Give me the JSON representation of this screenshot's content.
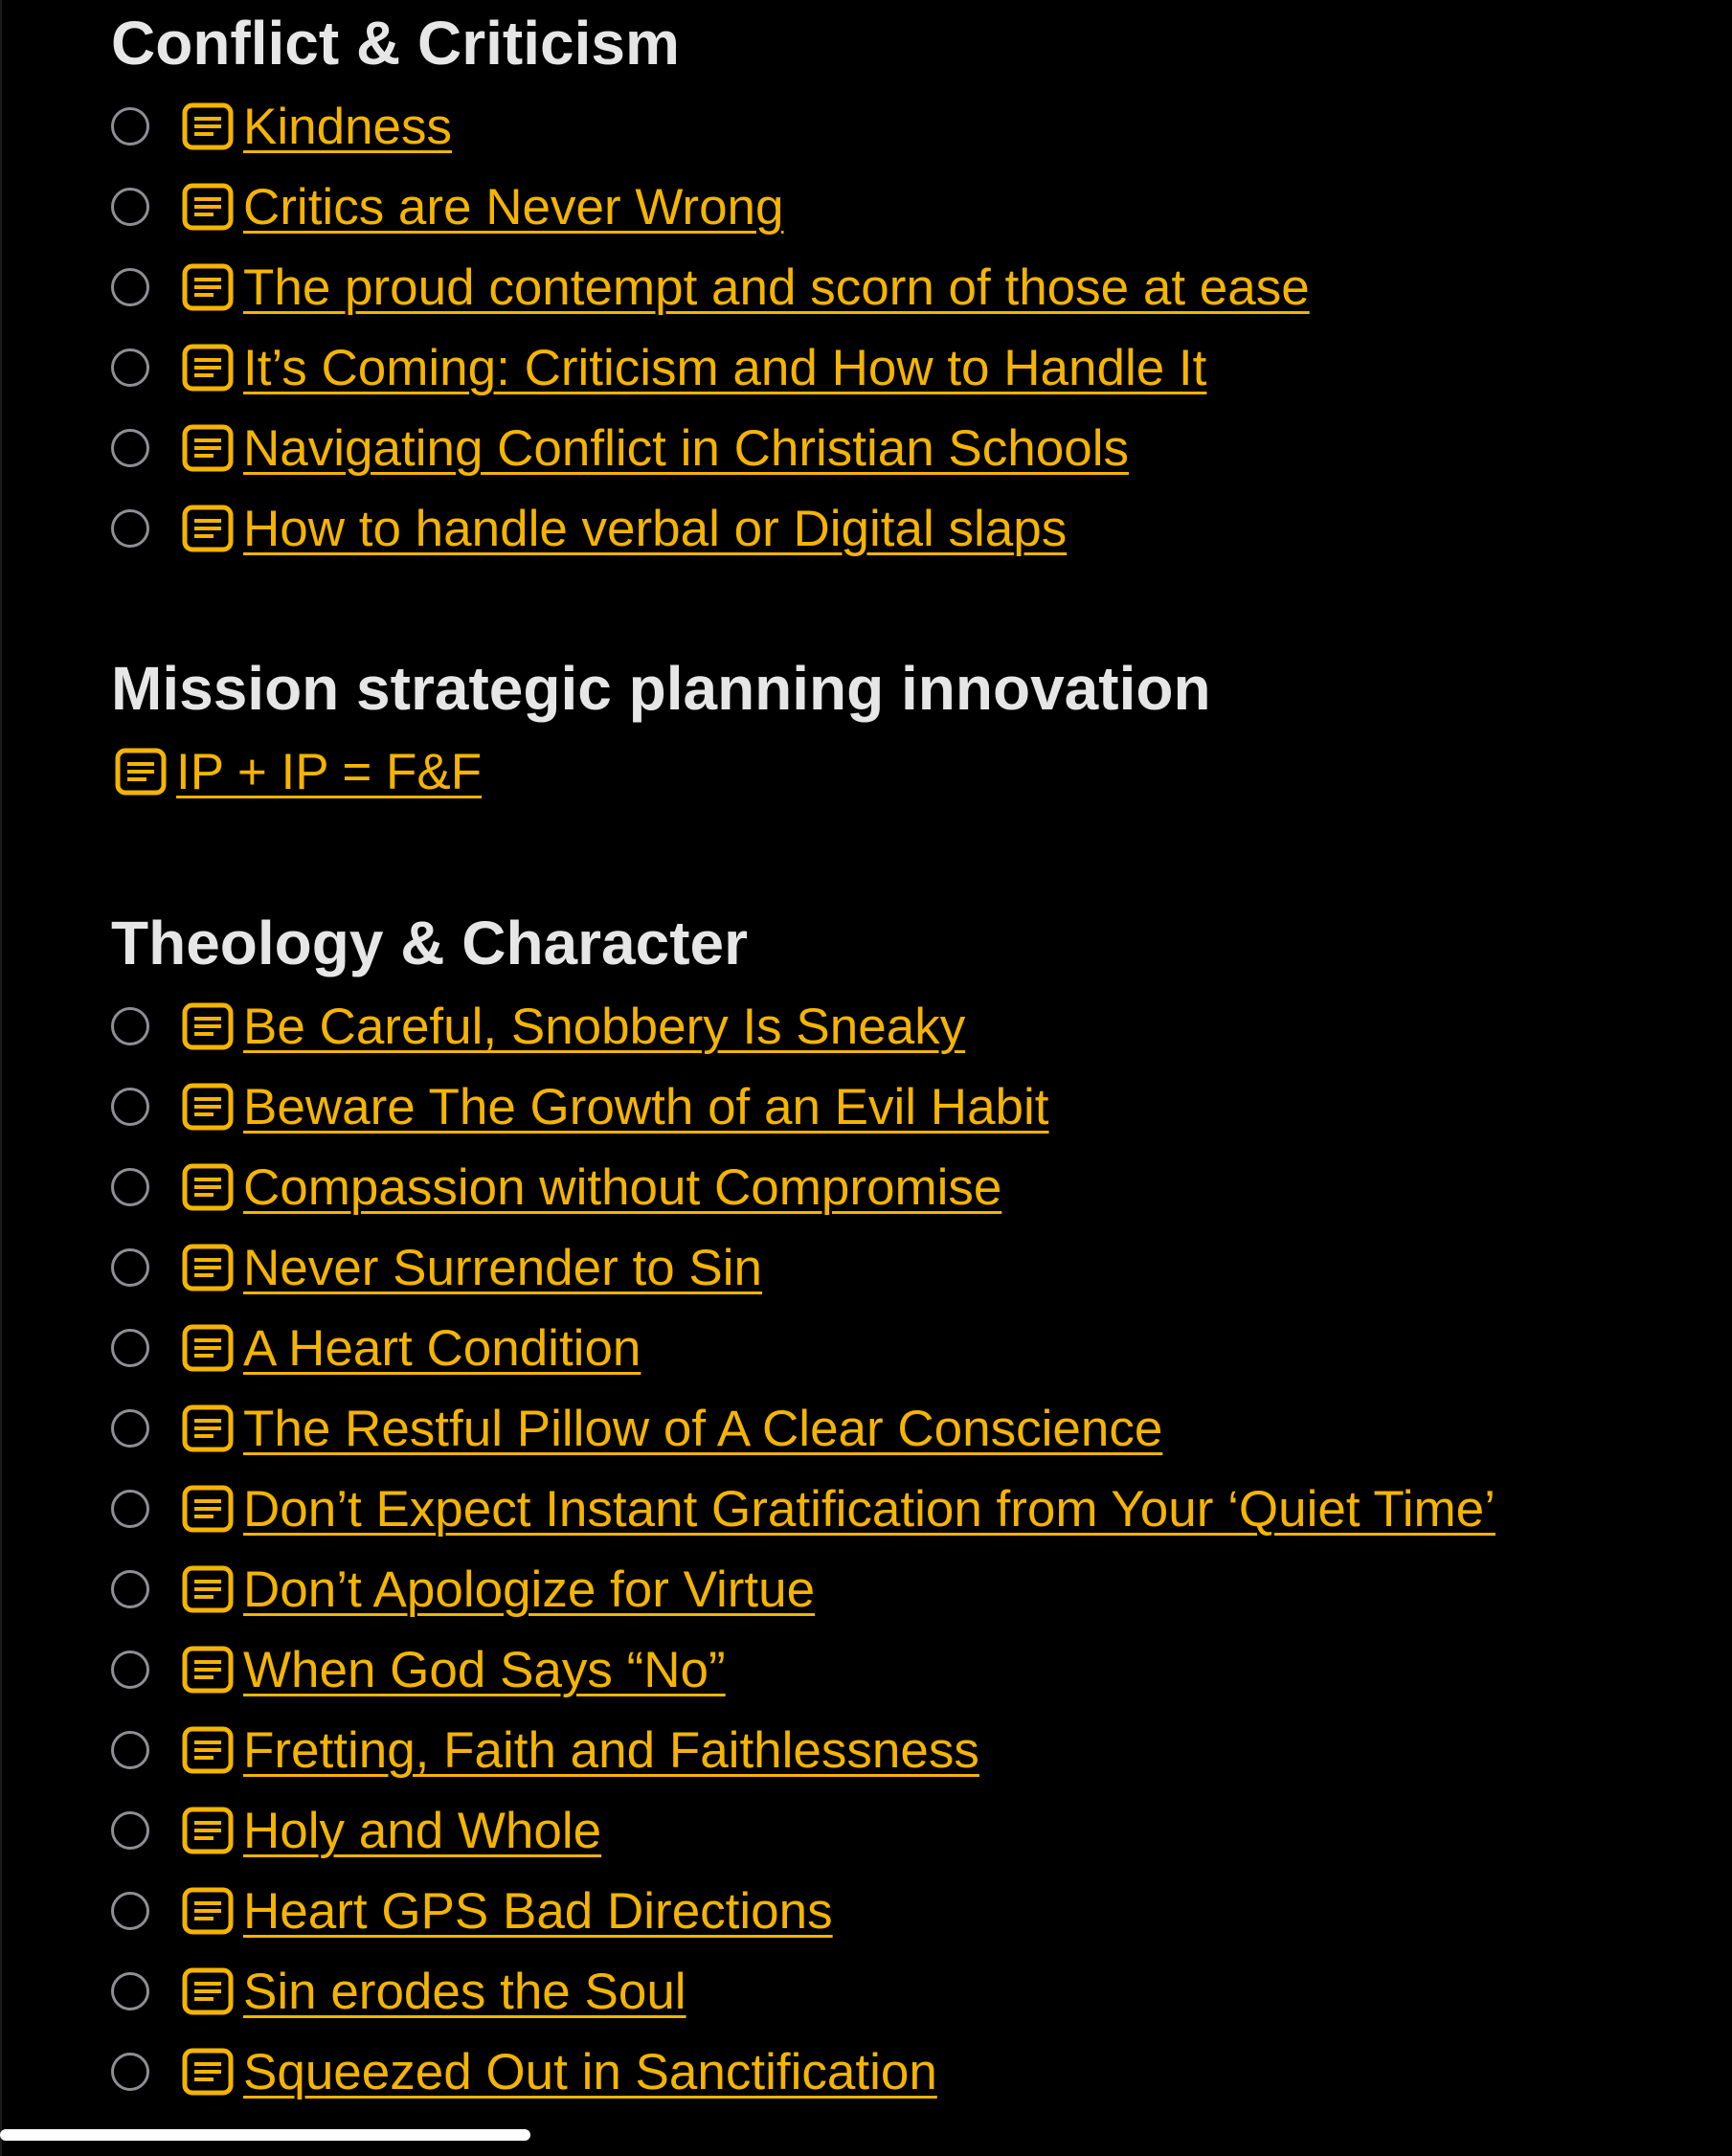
{
  "colors": {
    "background": "#000000",
    "heading": "#e6e6e6",
    "link": "#f4b400",
    "checkbox": "#8e8e93"
  },
  "sections": [
    {
      "title": "Conflict & Criticism",
      "items": [
        {
          "label": "Kindness",
          "checkbox": true,
          "icon": "note-icon"
        },
        {
          "label": "Critics are Never Wrong",
          "checkbox": true,
          "icon": "note-icon"
        },
        {
          "label": "The proud contempt and scorn of those at ease",
          "checkbox": true,
          "icon": "note-icon"
        },
        {
          "label": "It’s Coming: Criticism and How to Handle It",
          "checkbox": true,
          "icon": "note-icon"
        },
        {
          "label": "Navigating Conflict in Christian Schools",
          "checkbox": true,
          "icon": "note-icon"
        },
        {
          "label": "How to handle verbal or Digital slaps",
          "checkbox": true,
          "icon": "note-icon"
        }
      ]
    },
    {
      "title": "Mission strategic planning innovation",
      "items": [
        {
          "label": "IP + IP = F&F",
          "checkbox": false,
          "icon": "note-icon"
        }
      ]
    },
    {
      "title": "Theology & Character",
      "items": [
        {
          "label": "Be Careful, Snobbery Is Sneaky",
          "checkbox": true,
          "icon": "note-icon"
        },
        {
          "label": "Beware The Growth of an Evil Habit",
          "checkbox": true,
          "icon": "note-icon"
        },
        {
          "label": "Compassion without Compromise",
          "checkbox": true,
          "icon": "note-icon"
        },
        {
          "label": "Never Surrender to Sin",
          "checkbox": true,
          "icon": "note-icon"
        },
        {
          "label": "A Heart Condition",
          "checkbox": true,
          "icon": "note-icon"
        },
        {
          "label": "The Restful Pillow of A Clear Conscience",
          "checkbox": true,
          "icon": "note-icon"
        },
        {
          "label": "Don’t Expect Instant Gratification from Your ‘Quiet Time’",
          "checkbox": true,
          "icon": "note-icon"
        },
        {
          "label": "Don’t Apologize for Virtue",
          "checkbox": true,
          "icon": "note-icon"
        },
        {
          "label": "When God Says “No”",
          "checkbox": true,
          "icon": "note-icon"
        },
        {
          "label": "Fretting, Faith and Faithlessness",
          "checkbox": true,
          "icon": "note-icon"
        },
        {
          "label": "Holy and Whole",
          "checkbox": true,
          "icon": "note-icon"
        },
        {
          "label": "Heart GPS Bad Directions",
          "checkbox": true,
          "icon": "note-icon"
        },
        {
          "label": "Sin erodes the Soul",
          "checkbox": true,
          "icon": "note-icon"
        },
        {
          "label": "Squeezed Out in Sanctification",
          "checkbox": true,
          "icon": "note-icon"
        }
      ]
    }
  ]
}
